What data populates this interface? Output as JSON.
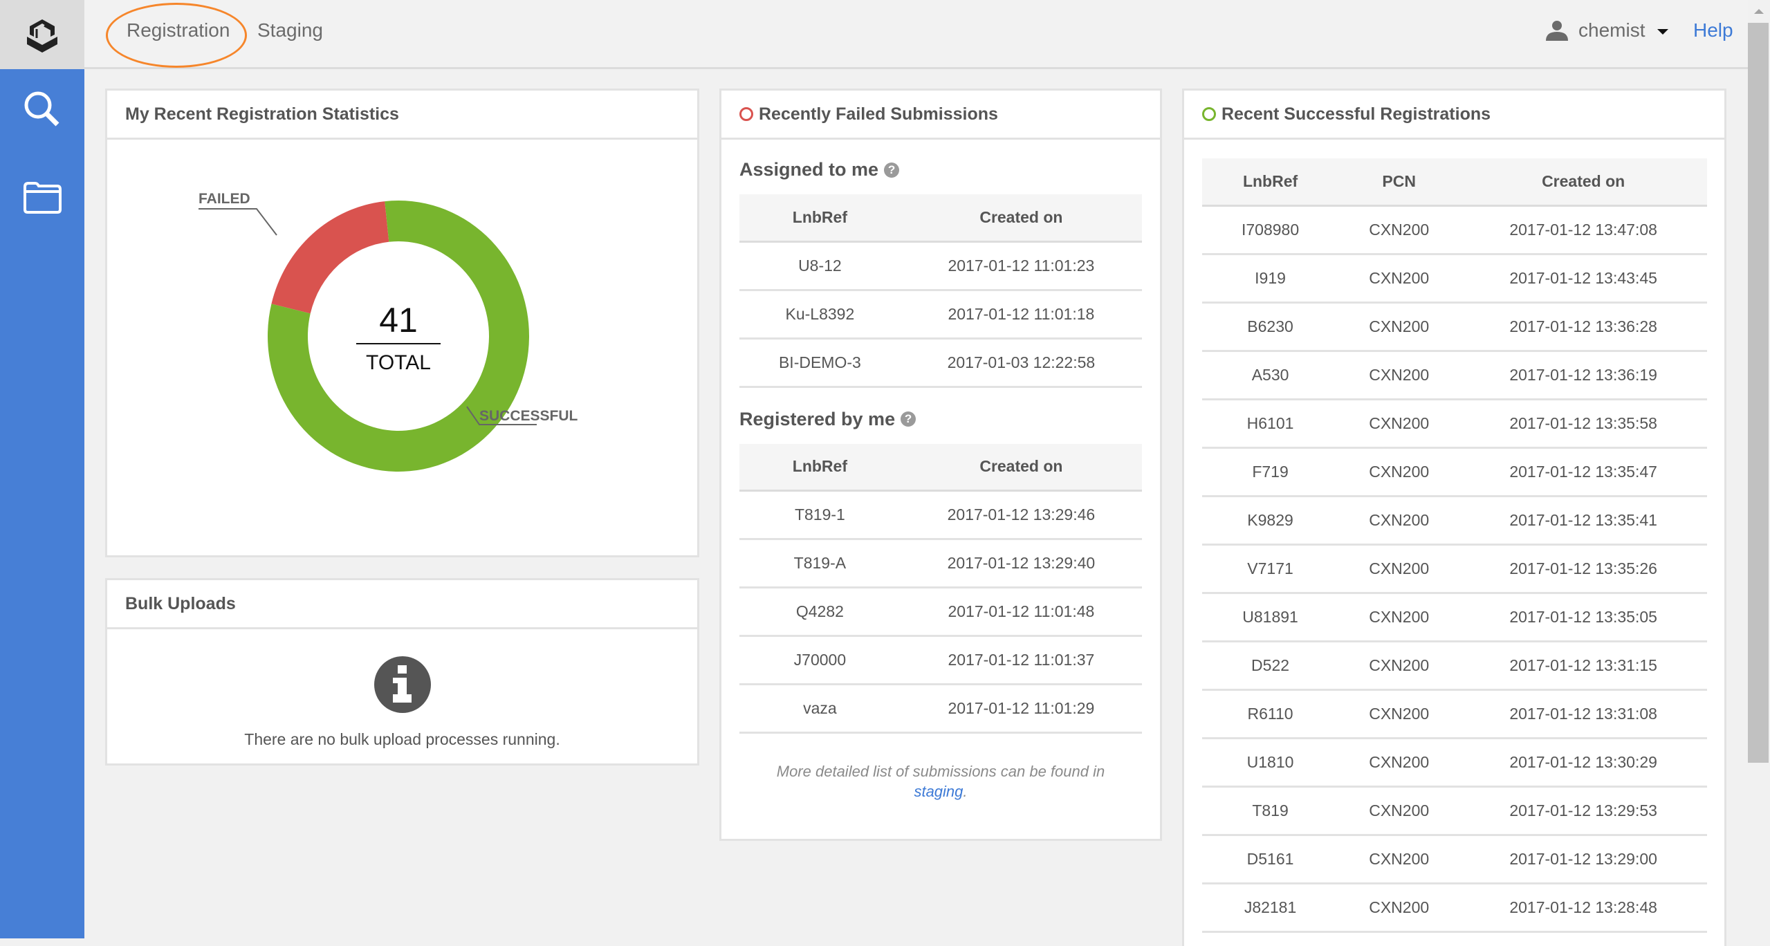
{
  "topbar": {
    "tabs": [
      {
        "label": "Registration",
        "active": true
      },
      {
        "label": "Staging",
        "active": false
      }
    ],
    "user": {
      "name": "chemist",
      "icon": "user-icon"
    },
    "help_label": "Help",
    "highlight_color": "#f6862b"
  },
  "sidebar": {
    "logo_icon": "hexagon-box-logo",
    "items": [
      {
        "icon": "search-icon",
        "label": "Search"
      },
      {
        "icon": "folder-icon",
        "label": "Browse"
      }
    ],
    "color": "#477fd6"
  },
  "stats_panel": {
    "title": "My Recent Registration Statistics",
    "center_value": "41",
    "center_label": "TOTAL"
  },
  "chart_data": {
    "type": "pie",
    "variant": "donut",
    "title": "My Recent Registration Statistics",
    "total": 41,
    "series": [
      {
        "name": "FAILED",
        "value": 8,
        "color": "#d9534f"
      },
      {
        "name": "SUCCESSFUL",
        "value": 33,
        "color": "#78b52e"
      }
    ],
    "labels": [
      "FAILED",
      "SUCCESSFUL"
    ],
    "legend": "callout-labels"
  },
  "bulk_panel": {
    "title": "Bulk Uploads",
    "icon": "info-icon",
    "message": "There are no bulk upload processes running."
  },
  "failed_panel": {
    "title": "Recently Failed Submissions",
    "status_color": "#d9534f",
    "assigned": {
      "heading": "Assigned to me",
      "columns": [
        "LnbRef",
        "Created on"
      ],
      "rows": [
        [
          "U8-12",
          "2017-01-12 11:01:23"
        ],
        [
          "Ku-L8392",
          "2017-01-12 11:01:18"
        ],
        [
          "BI-DEMO-3",
          "2017-01-03 12:22:58"
        ]
      ]
    },
    "registered": {
      "heading": "Registered by me",
      "columns": [
        "LnbRef",
        "Created on"
      ],
      "rows": [
        [
          "T819-1",
          "2017-01-12 13:29:46"
        ],
        [
          "T819-A",
          "2017-01-12 13:29:40"
        ],
        [
          "Q4282",
          "2017-01-12 11:01:48"
        ],
        [
          "J70000",
          "2017-01-12 11:01:37"
        ],
        [
          "vaza",
          "2017-01-12 11:01:29"
        ]
      ]
    },
    "footnote": "More detailed list of submissions can be found in",
    "footnote_link": "staging",
    "footnote_end": "."
  },
  "success_panel": {
    "title": "Recent Successful Registrations",
    "status_color": "#78b52e",
    "columns": [
      "LnbRef",
      "PCN",
      "Created on"
    ],
    "rows": [
      [
        "I708980",
        "CXN200",
        "2017-01-12 13:47:08"
      ],
      [
        "I919",
        "CXN200",
        "2017-01-12 13:43:45"
      ],
      [
        "B6230",
        "CXN200",
        "2017-01-12 13:36:28"
      ],
      [
        "A530",
        "CXN200",
        "2017-01-12 13:36:19"
      ],
      [
        "H6101",
        "CXN200",
        "2017-01-12 13:35:58"
      ],
      [
        "F719",
        "CXN200",
        "2017-01-12 13:35:47"
      ],
      [
        "K9829",
        "CXN200",
        "2017-01-12 13:35:41"
      ],
      [
        "V7171",
        "CXN200",
        "2017-01-12 13:35:26"
      ],
      [
        "U81891",
        "CXN200",
        "2017-01-12 13:35:05"
      ],
      [
        "D522",
        "CXN200",
        "2017-01-12 13:31:15"
      ],
      [
        "R6110",
        "CXN200",
        "2017-01-12 13:31:08"
      ],
      [
        "U1810",
        "CXN200",
        "2017-01-12 13:30:29"
      ],
      [
        "T819",
        "CXN200",
        "2017-01-12 13:29:53"
      ],
      [
        "D5161",
        "CXN200",
        "2017-01-12 13:29:00"
      ],
      [
        "J82181",
        "CXN200",
        "2017-01-12 13:28:48"
      ]
    ]
  }
}
